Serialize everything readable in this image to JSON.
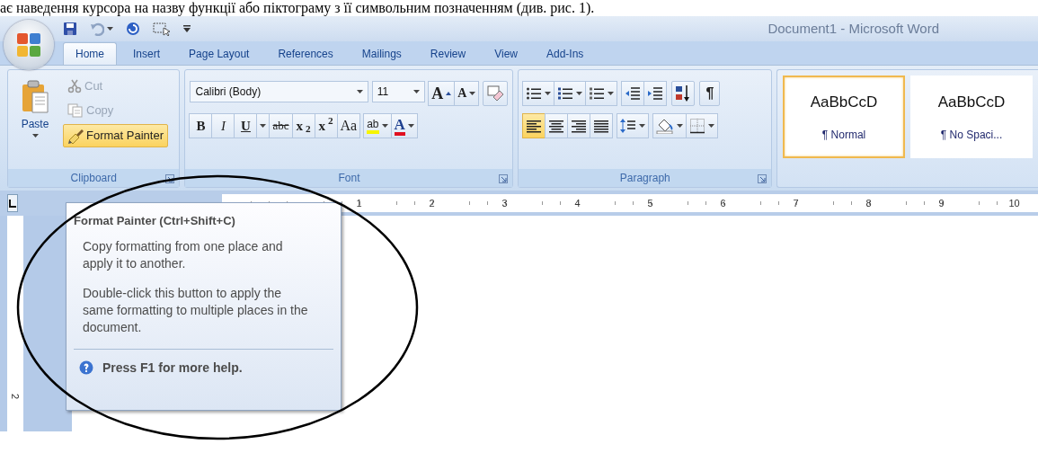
{
  "caption": "ає наведення курсора на назву функції або піктограму з її символьним позначенням (див. рис. 1).",
  "title": "Document1 - Microsoft Word",
  "tabs": [
    {
      "label": "Home",
      "selected": true
    },
    {
      "label": "Insert",
      "selected": false
    },
    {
      "label": "Page Layout",
      "selected": false
    },
    {
      "label": "References",
      "selected": false
    },
    {
      "label": "Mailings",
      "selected": false
    },
    {
      "label": "Review",
      "selected": false
    },
    {
      "label": "View",
      "selected": false
    },
    {
      "label": "Add-Ins",
      "selected": false
    }
  ],
  "clipboard": {
    "label": "Clipboard",
    "paste": "Paste",
    "items": [
      {
        "kind": "cut",
        "label": "Cut",
        "disabled": true,
        "highlighted": false
      },
      {
        "kind": "copy",
        "label": "Copy",
        "disabled": true,
        "highlighted": false
      },
      {
        "kind": "painter",
        "label": "Format Painter",
        "disabled": false,
        "highlighted": true
      }
    ]
  },
  "font": {
    "label": "Font",
    "name": "Calibri (Body)",
    "size": "11",
    "grow": "A",
    "shrink": "A",
    "highlight": "ab",
    "font_color_letter": "A",
    "format_buttons": [
      {
        "kind": "bold",
        "label": "B"
      },
      {
        "kind": "italic",
        "label": "I"
      },
      {
        "kind": "underline",
        "label": "U"
      },
      {
        "kind": "strikethrough",
        "label": "abc"
      },
      {
        "kind": "subscript",
        "label": "x$_{2}$"
      },
      {
        "kind": "superscript",
        "label": "x$^{2}$"
      },
      {
        "kind": "case",
        "label": "Aa"
      }
    ]
  },
  "paragraph": {
    "label": "Paragraph",
    "marks": "¶",
    "alignment": [
      {
        "kind": "left",
        "selected": true
      },
      {
        "kind": "center",
        "selected": false
      },
      {
        "kind": "right",
        "selected": false
      },
      {
        "kind": "justify",
        "selected": false
      }
    ]
  },
  "styles": [
    {
      "sample": "AaBbCcD",
      "name": "¶ Normal",
      "selected": true
    },
    {
      "sample": "AaBbCcD",
      "name": "¶ No Spaci...",
      "selected": false
    }
  ],
  "ruler": {
    "numbers": [
      "1",
      "2",
      "3",
      "4",
      "5",
      "6",
      "7",
      "8",
      "9",
      "10"
    ],
    "vertical_numbers": [
      "2"
    ]
  },
  "tooltip": {
    "title": "Format Painter (Ctrl+Shift+C)",
    "paragraphs": [
      "Copy formatting from one place and apply it to another.",
      "Double-click this button to apply the same formatting to multiple places in the document."
    ],
    "help": "Press F1 for more help."
  }
}
